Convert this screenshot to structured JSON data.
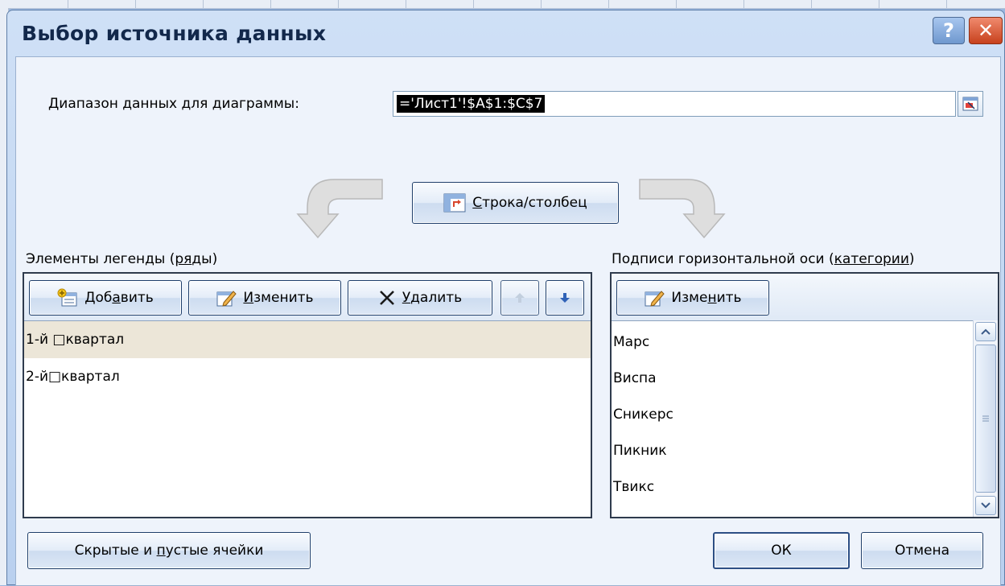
{
  "dialog": {
    "title": "Выбор источника данных",
    "help_label": "?",
    "close_label": "✕"
  },
  "range": {
    "label_prefix": "Д",
    "label_rest": "иапазон данных для диаграммы:",
    "value": "='Лист1'!$A$1:$C$7"
  },
  "switch_button": {
    "label_u": "С",
    "label_rest": "трока/столбец"
  },
  "legend": {
    "title_main": "Элементы легенды (",
    "title_u": "ря",
    "title_end": "ды)",
    "add_label_a": "Доб",
    "add_label_u": "а",
    "add_label_b": "вить",
    "edit_label_u": "И",
    "edit_label_rest": "зменить",
    "delete_label_u": "У",
    "delete_label_rest": "далить",
    "items": [
      "1-й □квартал",
      "2-й□квартал"
    ]
  },
  "axis": {
    "title_main": "Подписи горизонтальной оси (",
    "title_u": "категории",
    "title_end": ")",
    "edit_label_a": "Изме",
    "edit_label_u": "н",
    "edit_label_b": "ить",
    "categories": [
      "Марс",
      "Виспа",
      "Сникерс",
      "Пикник",
      "Твикс"
    ]
  },
  "footer": {
    "hidden_cells_a": "Скрытые и ",
    "hidden_cells_u": "п",
    "hidden_cells_b": "устые ячейки",
    "ok_label": "ОК",
    "cancel_label": "Отмена"
  },
  "colors": {
    "accent": "#2c4e84",
    "selection": "#ece6d8",
    "titlebar": "#b9d0ef",
    "close": "#c7411d"
  }
}
